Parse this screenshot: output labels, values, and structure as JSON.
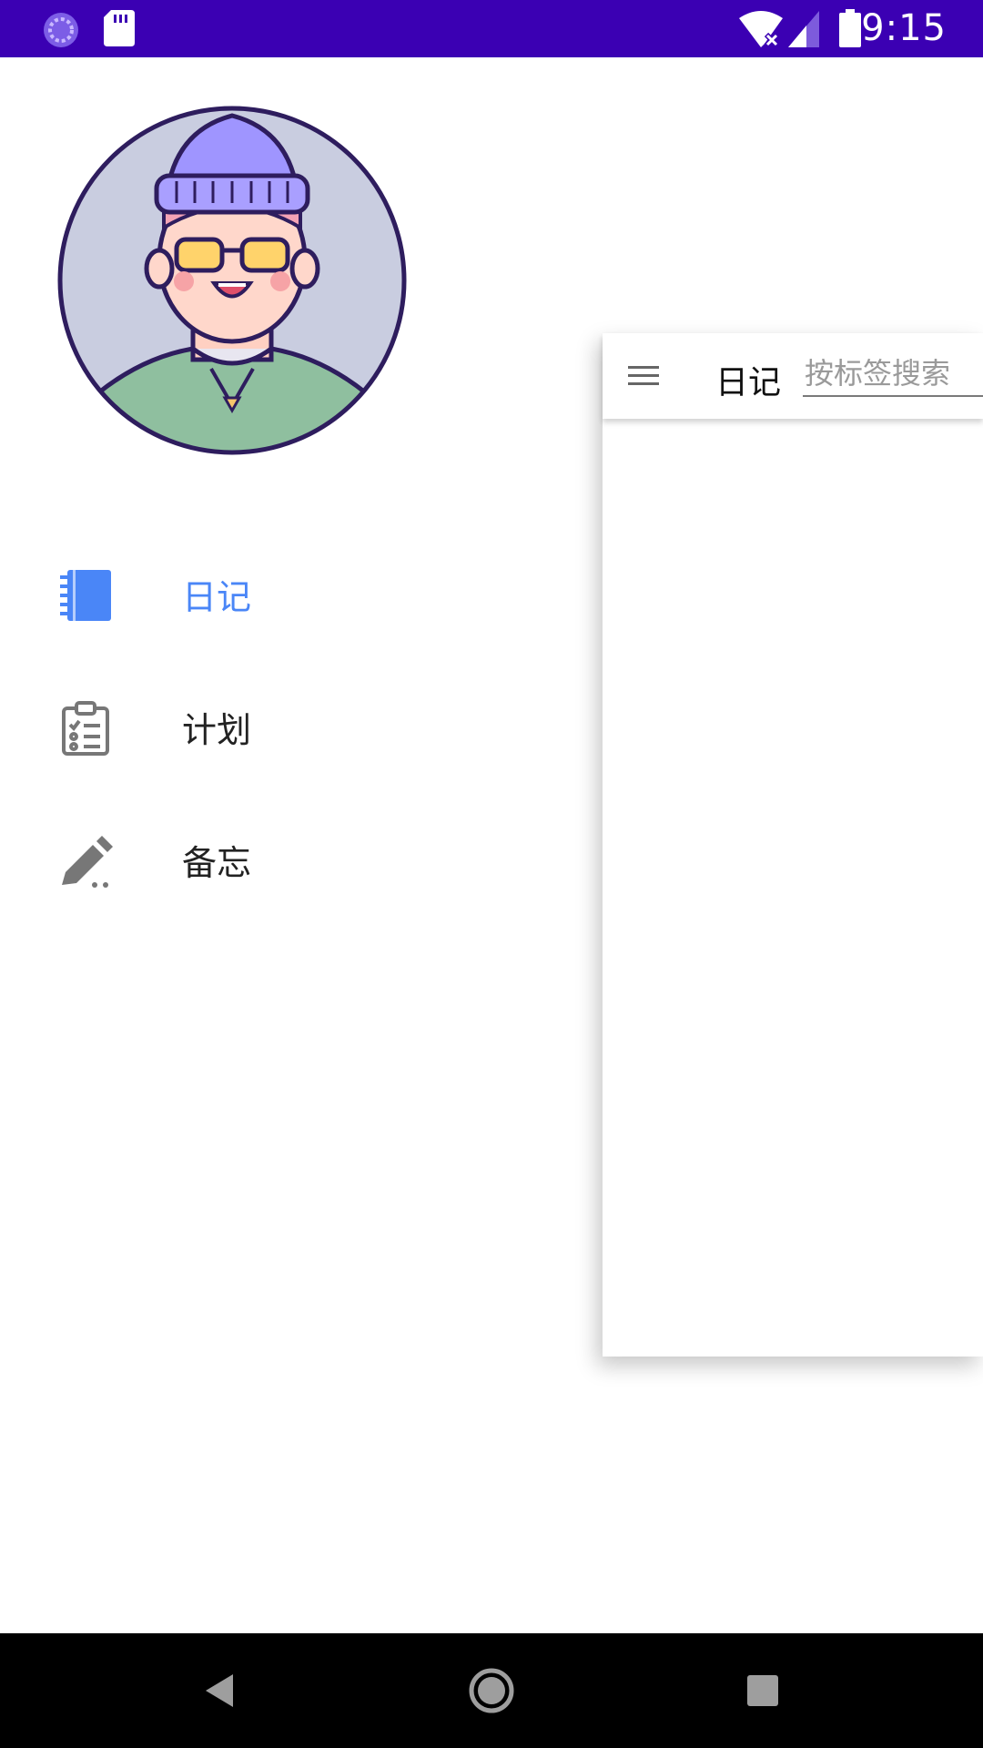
{
  "status_bar": {
    "time": "9:15",
    "background": "#3b00b3",
    "left_icons": [
      "sync-icon",
      "sd-card-icon"
    ],
    "right_icons": [
      "wifi-off-icon",
      "cell-signal-icon",
      "battery-icon"
    ]
  },
  "drawer": {
    "avatar": "avatar",
    "accent_color": "#4a86f7",
    "items": [
      {
        "label": "日记",
        "icon": "notebook-icon",
        "active": true
      },
      {
        "label": "计划",
        "icon": "clipboard-checklist-icon",
        "active": false
      },
      {
        "label": "备忘",
        "icon": "pencil-icon",
        "active": false
      }
    ]
  },
  "toolbar": {
    "menu_icon": "hamburger-menu-icon",
    "title": "日记",
    "search_placeholder": "按标签搜索"
  },
  "nav_bar": {
    "buttons": [
      "back-icon",
      "home-icon",
      "recents-icon"
    ]
  }
}
